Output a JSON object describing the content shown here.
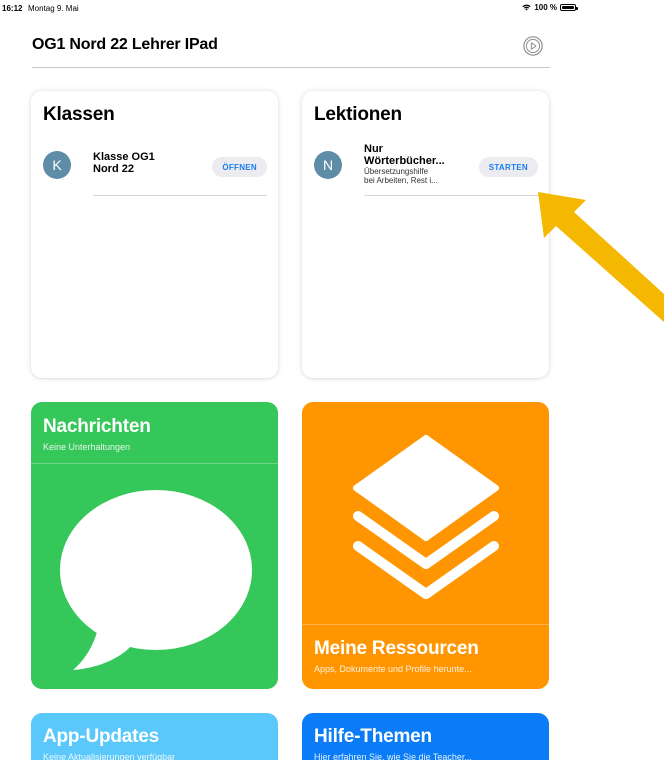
{
  "status_bar": {
    "time": "16:12",
    "date": "Montag 9. Mai",
    "battery": "100 %"
  },
  "header": {
    "title": "OG1 Nord 22 Lehrer IPad"
  },
  "classes_card": {
    "title": "Klassen",
    "item": {
      "avatar_letter": "K",
      "name_line1": "Klasse OG1",
      "name_line2": "Nord 22",
      "button": "ÖFFNEN"
    }
  },
  "lessons_card": {
    "title": "Lektionen",
    "item": {
      "avatar_letter": "N",
      "name_line1": "Nur",
      "name_line2": "Wörterbücher...",
      "desc_line1": "Übersetzungshilfe",
      "desc_line2": "bei Arbeiten, Rest i...",
      "button": "STARTEN"
    }
  },
  "messages_card": {
    "title": "Nachrichten",
    "subtitle": "Keine Unterhaltungen"
  },
  "resources_card": {
    "title": "Meine Ressourcen",
    "subtitle": "Apps, Dokumente und Profile herunte..."
  },
  "updates_card": {
    "title": "App-Updates",
    "subtitle": "Keine Aktualisierungen verfügbar"
  },
  "help_card": {
    "title": "Hilfe-Themen",
    "subtitle": "Hier erfahren Sie, wie Sie die Teacher..."
  },
  "colors": {
    "green": "#35c759",
    "orange": "#ff9500",
    "light_blue": "#5ac8fa",
    "blue": "#0a7cf7",
    "accent": "#1a7cf0",
    "arrow": "#f5b800"
  },
  "icons": [
    "wifi-icon",
    "battery-icon",
    "settings-icon",
    "message-bubble-icon",
    "layers-icon",
    "arrow-annotation"
  ]
}
